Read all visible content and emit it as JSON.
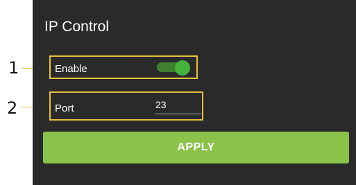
{
  "panel": {
    "title": "IP Control",
    "enable": {
      "label": "Enable",
      "on": true
    },
    "port": {
      "label": "Port",
      "value": "23"
    },
    "apply_label": "APPLY"
  },
  "callouts": [
    "1",
    "2"
  ],
  "colors": {
    "panel_bg": "#2a2a2a",
    "accent": "#8bc34a",
    "toggle_on": "#45b23c",
    "callout": "#e8c23a"
  }
}
